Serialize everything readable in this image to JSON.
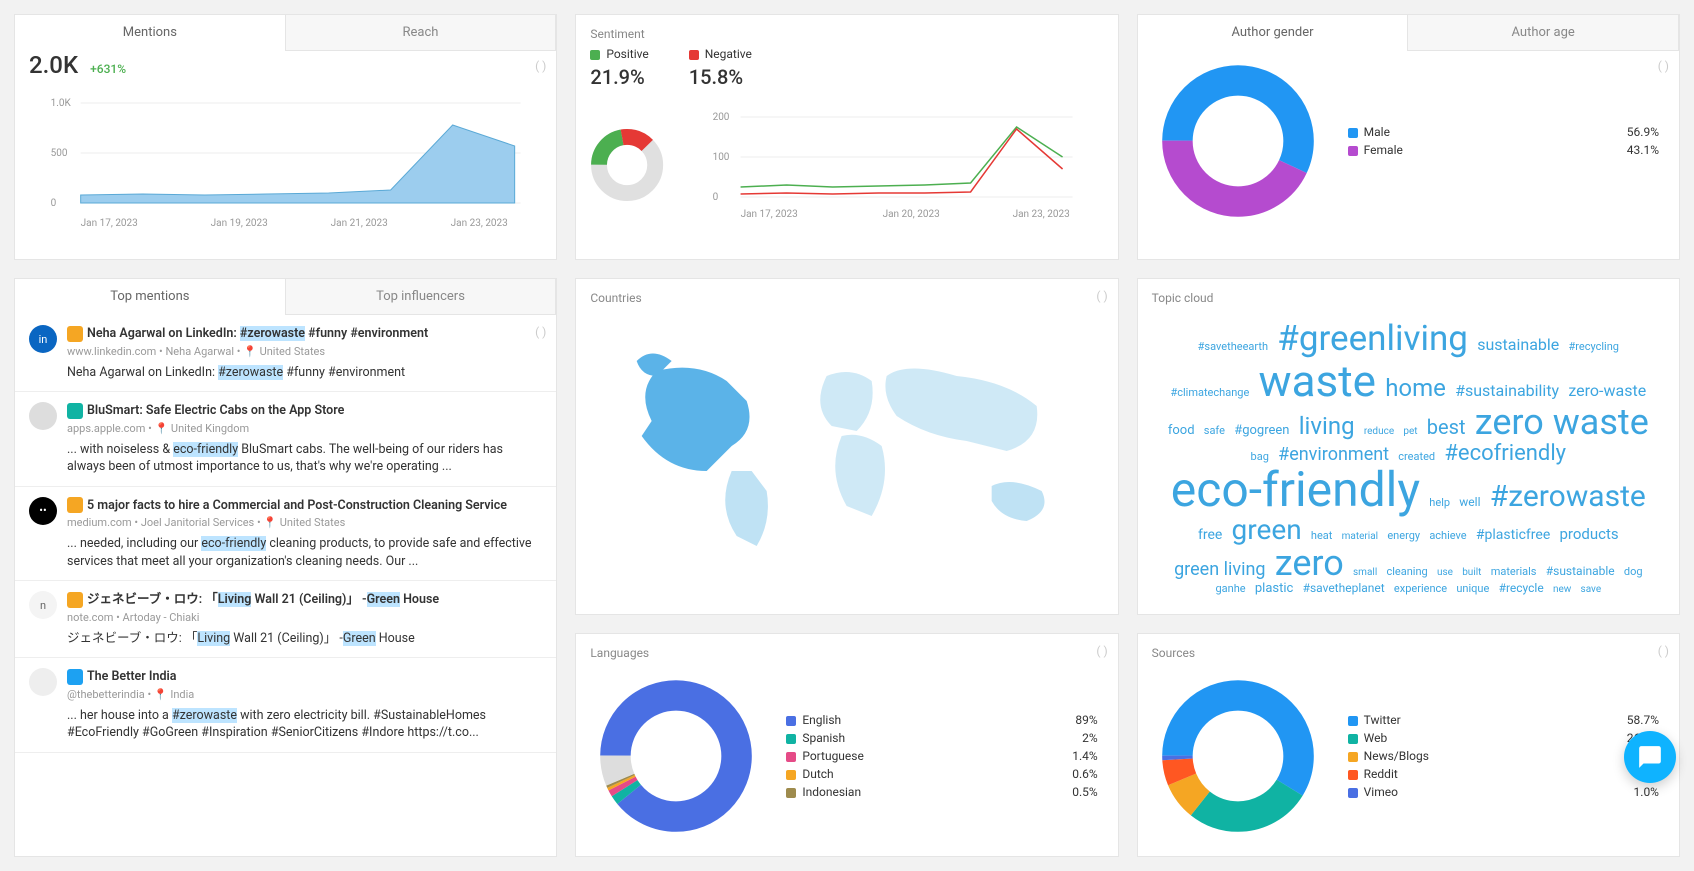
{
  "row1": {
    "mentions_tab": "Mentions",
    "reach_tab": "Reach",
    "dots": "(  )",
    "mentions": {
      "value": "2.0K",
      "delta": "+631%",
      "y_ticks": [
        "1.0K",
        "500",
        "0"
      ],
      "x_ticks": [
        "Jan 17, 2023",
        "Jan 19, 2023",
        "Jan 21, 2023",
        "Jan 23, 2023"
      ]
    },
    "sentiment": {
      "title": "Sentiment",
      "positive_label": "Positive",
      "positive_pct": "21.9%",
      "negative_label": "Negative",
      "negative_pct": "15.8%",
      "y_ticks": [
        "200",
        "100",
        "0"
      ],
      "x_ticks": [
        "Jan 17, 2023",
        "Jan 20, 2023",
        "Jan 23, 2023"
      ]
    },
    "gender": {
      "tabA": "Author gender",
      "tabB": "Author age",
      "legend": [
        {
          "name": "Male",
          "pct": "56.9%",
          "color": "#2196f3"
        },
        {
          "name": "Female",
          "pct": "43.1%",
          "color": "#b54bcf"
        }
      ]
    }
  },
  "row2": {
    "top_mentions_tab": "Top mentions",
    "top_influencers_tab": "Top influencers",
    "items": [
      {
        "avatar": "in",
        "avatar_bg": "#0a66c2",
        "badge": "#f5a623",
        "title_pre": "Neha Agarwal on LinkedIn: ",
        "hl1": "#zerowaste",
        "title_post": " #funny #environment",
        "meta": "www.linkedin.com  •  Neha Agarwal  •  📍 United States",
        "snippet_pre": "Neha Agarwal on LinkedIn: ",
        "snippet_hl": "#zerowaste",
        "snippet_post": " #funny #environment"
      },
      {
        "avatar": "",
        "avatar_bg": "#ddd",
        "badge": "#10b3a3",
        "title_pre": "BluSmart: Safe Electric Cabs on the App Store",
        "hl1": "",
        "title_post": "",
        "meta": "apps.apple.com  •  📍 United Kingdom",
        "snippet_pre": "... with noiseless & ",
        "snippet_hl": "eco-friendly",
        "snippet_post": " BluSmart cabs. The well-being of our riders has always been of utmost importance to us, that's why we're operating ..."
      },
      {
        "avatar": "••",
        "avatar_bg": "#000",
        "badge": "#f5a623",
        "title_pre": "5 major facts to hire a Commercial and Post-Construction Cleaning Service",
        "hl1": "",
        "title_post": "",
        "meta": "medium.com  •  Joel Janitorial Services  •  📍 United States",
        "snippet_pre": "... needed, including our ",
        "snippet_hl": "eco-friendly",
        "snippet_post": " cleaning products, to provide safe and effective services that meet all your organization's cleaning needs. Our ..."
      },
      {
        "avatar": "n",
        "avatar_bg": "#f4f4f4",
        "badge": "#f5a623",
        "title_pre": "ジェネビーブ・ロウ:    「",
        "hl1": "Living",
        "title_mid": " Wall 21 (Ceiling)」  -",
        "hl2": "Green",
        "title_post": " House",
        "meta": "note.com  •  Artoday - Chiaki",
        "snippet_pre": "ジェネビーブ・ロウ:    「",
        "snippet_hl": "Living",
        "snippet_mid": " Wall 21 (Ceiling)」 -",
        "snippet_hl2": "Green",
        "snippet_post": " House"
      },
      {
        "avatar": "",
        "avatar_bg": "#eee",
        "badge": "#1da1f2",
        "title_pre": "The Better India",
        "hl1": "",
        "title_post": "",
        "meta": "@thebetterindia  •  📍 India",
        "snippet_pre": "... her house into a ",
        "snippet_hl": "#zerowaste",
        "snippet_post": " with zero electricity bill. #SustainableHomes #EcoFriendly #GoGreen #Inspiration #SeniorCitizens #Indore https://t.co..."
      }
    ],
    "countries_title": "Countries",
    "topic_title": "Topic cloud",
    "topics": [
      {
        "t": "#savetheearth",
        "s": 11
      },
      {
        "t": "#greenliving",
        "s": 35
      },
      {
        "t": "sustainable",
        "s": 16
      },
      {
        "t": "#recycling",
        "s": 11
      },
      {
        "t": "#climatechange",
        "s": 11
      },
      {
        "t": "waste",
        "s": 44
      },
      {
        "t": "home",
        "s": 24
      },
      {
        "t": "#sustainability",
        "s": 16
      },
      {
        "t": "zero-waste",
        "s": 16
      },
      {
        "t": "food",
        "s": 13
      },
      {
        "t": "safe",
        "s": 11
      },
      {
        "t": "#gogreen",
        "s": 13
      },
      {
        "t": "living",
        "s": 24
      },
      {
        "t": "reduce",
        "s": 10
      },
      {
        "t": "pet",
        "s": 10
      },
      {
        "t": "best",
        "s": 20
      },
      {
        "t": "zero waste",
        "s": 36
      },
      {
        "t": "bag",
        "s": 11
      },
      {
        "t": "#environment",
        "s": 18
      },
      {
        "t": "created",
        "s": 11
      },
      {
        "t": "#ecofriendly",
        "s": 22
      },
      {
        "t": "eco-friendly",
        "s": 48
      },
      {
        "t": "help",
        "s": 11
      },
      {
        "t": "well",
        "s": 12
      },
      {
        "t": "#zerowaste",
        "s": 30
      },
      {
        "t": "free",
        "s": 14
      },
      {
        "t": "green",
        "s": 28
      },
      {
        "t": "heat",
        "s": 11
      },
      {
        "t": "material",
        "s": 10
      },
      {
        "t": "energy",
        "s": 11
      },
      {
        "t": "achieve",
        "s": 11
      },
      {
        "t": "#plasticfree",
        "s": 14
      },
      {
        "t": "products",
        "s": 15
      },
      {
        "t": "green living",
        "s": 18
      },
      {
        "t": "zero",
        "s": 36
      },
      {
        "t": "small",
        "s": 10
      },
      {
        "t": "cleaning",
        "s": 11
      },
      {
        "t": "use",
        "s": 10
      },
      {
        "t": "built",
        "s": 10
      },
      {
        "t": "materials",
        "s": 11
      },
      {
        "t": "#sustainable",
        "s": 12
      },
      {
        "t": "dog",
        "s": 11
      },
      {
        "t": "ganhe",
        "s": 11
      },
      {
        "t": "plastic",
        "s": 13
      },
      {
        "t": "#savetheplanet",
        "s": 12
      },
      {
        "t": "experience",
        "s": 11
      },
      {
        "t": "unique",
        "s": 11
      },
      {
        "t": "#recycle",
        "s": 12
      },
      {
        "t": "new",
        "s": 10
      },
      {
        "t": "save",
        "s": 10
      }
    ]
  },
  "row3": {
    "languages_title": "Languages",
    "languages": [
      {
        "name": "English",
        "pct": "89%",
        "color": "#4a6fe3"
      },
      {
        "name": "Spanish",
        "pct": "2%",
        "color": "#10b3a3"
      },
      {
        "name": "Portuguese",
        "pct": "1.4%",
        "color": "#e54b87"
      },
      {
        "name": "Dutch",
        "pct": "0.6%",
        "color": "#f5a623"
      },
      {
        "name": "Indonesian",
        "pct": "0.5%",
        "color": "#9e8b4d"
      }
    ],
    "sources_title": "Sources",
    "sources": [
      {
        "name": "Twitter",
        "pct": "58.7%",
        "color": "#2196f3"
      },
      {
        "name": "Web",
        "pct": "26.9%",
        "color": "#10b3a3"
      },
      {
        "name": "News/Blogs",
        "pct": "8.0%",
        "color": "#f5a623"
      },
      {
        "name": "Reddit",
        "pct": "5.4%",
        "color": "#ff5722"
      },
      {
        "name": "Vimeo",
        "pct": "1.0%",
        "color": "#4a6fe3"
      }
    ]
  },
  "chart_data": {
    "mentions_timeseries": {
      "type": "area",
      "x": [
        "Jan 17",
        "Jan 18",
        "Jan 19",
        "Jan 20",
        "Jan 21",
        "Jan 22",
        "Jan 23",
        "Jan 24"
      ],
      "values": [
        80,
        90,
        80,
        90,
        100,
        130,
        780,
        570
      ],
      "ylim": [
        0,
        1000
      ]
    },
    "sentiment_donut": {
      "type": "pie",
      "series": [
        {
          "name": "Positive",
          "value": 21.9,
          "color": "#4caf50"
        },
        {
          "name": "Negative",
          "value": 15.8,
          "color": "#e53935"
        },
        {
          "name": "Neutral",
          "value": 62.3,
          "color": "#e0e0e0"
        }
      ]
    },
    "sentiment_lines": {
      "type": "line",
      "x": [
        "Jan 17",
        "Jan 18",
        "Jan 19",
        "Jan 20",
        "Jan 21",
        "Jan 22",
        "Jan 23",
        "Jan 24"
      ],
      "series": [
        {
          "name": "Positive",
          "color": "#4caf50",
          "values": [
            25,
            30,
            25,
            28,
            30,
            35,
            175,
            100
          ]
        },
        {
          "name": "Negative",
          "color": "#e53935",
          "values": [
            8,
            10,
            8,
            9,
            10,
            12,
            170,
            70
          ]
        }
      ],
      "ylim": [
        0,
        200
      ]
    },
    "gender_donut": {
      "type": "pie",
      "series": [
        {
          "name": "Male",
          "value": 56.9,
          "color": "#2196f3"
        },
        {
          "name": "Female",
          "value": 43.1,
          "color": "#b54bcf"
        }
      ]
    },
    "languages_donut": {
      "type": "pie",
      "series": [
        {
          "name": "English",
          "value": 89,
          "color": "#4a6fe3"
        },
        {
          "name": "Spanish",
          "value": 2,
          "color": "#10b3a3"
        },
        {
          "name": "Portuguese",
          "value": 1.4,
          "color": "#e54b87"
        },
        {
          "name": "Dutch",
          "value": 0.6,
          "color": "#f5a623"
        },
        {
          "name": "Indonesian",
          "value": 0.5,
          "color": "#9e8b4d"
        },
        {
          "name": "Other",
          "value": 6.5,
          "color": "#ddd"
        }
      ]
    },
    "sources_donut": {
      "type": "pie",
      "series": [
        {
          "name": "Twitter",
          "value": 58.7,
          "color": "#2196f3"
        },
        {
          "name": "Web",
          "value": 26.9,
          "color": "#10b3a3"
        },
        {
          "name": "News/Blogs",
          "value": 8.0,
          "color": "#f5a623"
        },
        {
          "name": "Reddit",
          "value": 5.4,
          "color": "#ff5722"
        },
        {
          "name": "Vimeo",
          "value": 1.0,
          "color": "#4a6fe3"
        }
      ]
    }
  }
}
